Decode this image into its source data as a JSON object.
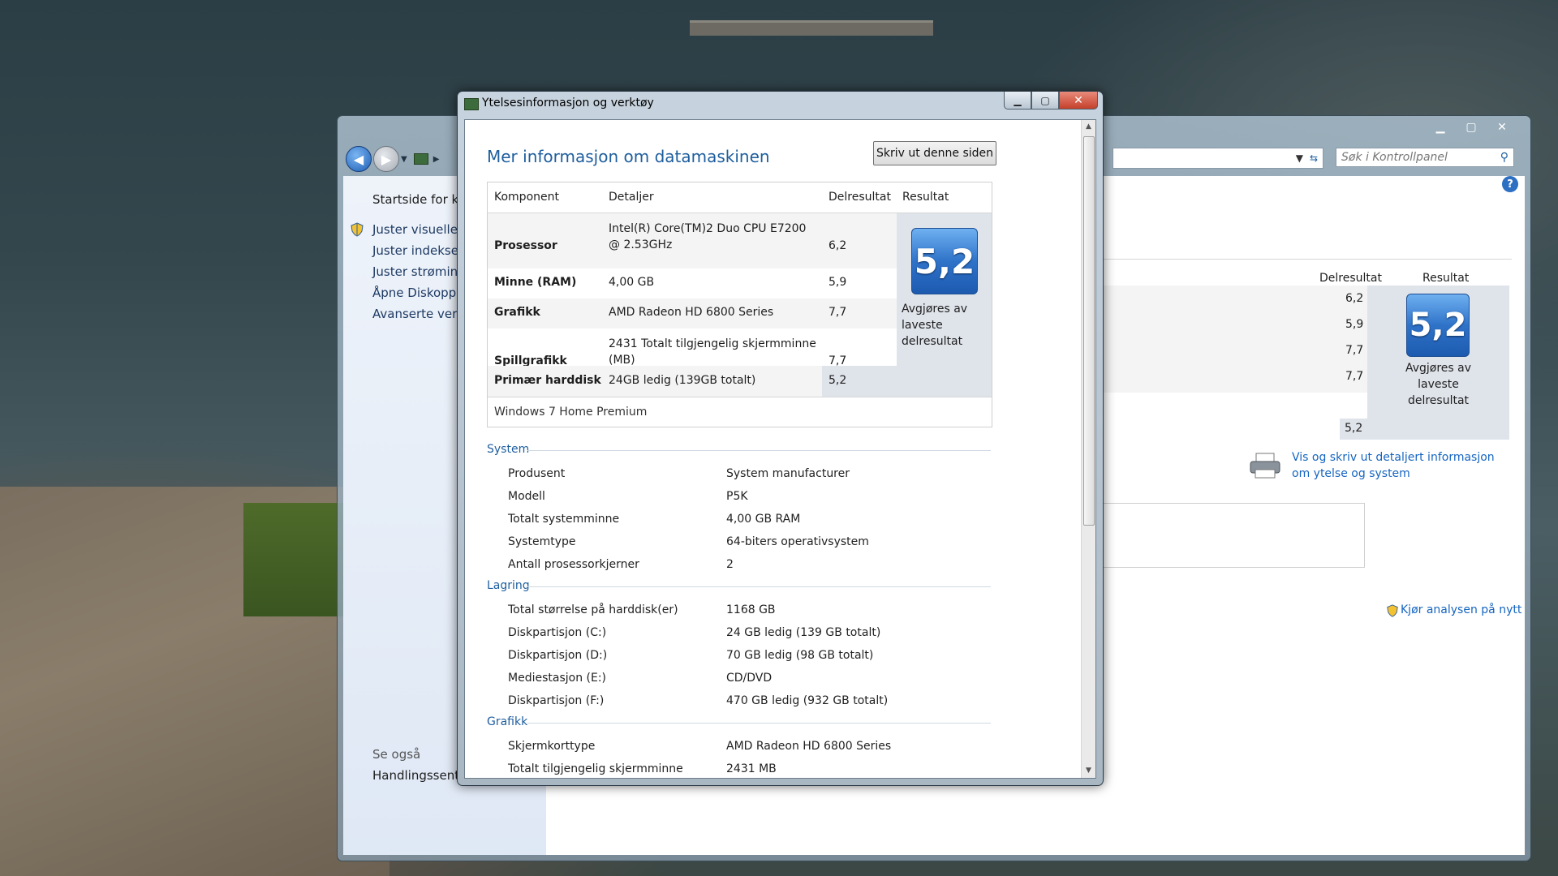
{
  "background_window": {
    "search_placeholder": "Søk i Kontrollpanel",
    "sidebar": {
      "items": [
        "Startside for ko",
        "Juster visuelle e",
        "Juster indekseri",
        "Juster strøminn",
        "Åpne Diskoppr",
        "Avanserte verkt"
      ],
      "see_also": "Se også",
      "action_center": "Handlingssenter"
    },
    "table": {
      "col_subscore": "Delresultat",
      "col_result": "Resultat",
      "scores": [
        "6,2",
        "5,9",
        "7,7",
        "7,7",
        "5,2"
      ],
      "base_score": "5,2",
      "note": "Avgjøres av laveste delresultat"
    },
    "print_link": "Vis og skriv ut detaljert informasjon om ytelse og system",
    "rerun_link": "Kjør analysen på nytt"
  },
  "dialog": {
    "title": "Ytelsesinformasjon og verktøy",
    "heading": "Mer informasjon om datamaskinen",
    "print_button": "Skriv ut denne siden",
    "components": {
      "headers": [
        "Komponent",
        "Detaljer",
        "Delresultat",
        "Resultat"
      ],
      "rows": [
        {
          "name": "Prosessor",
          "detail": "Intel(R) Core(TM)2 Duo CPU E7200 @ 2.53GHz",
          "score": "6,2"
        },
        {
          "name": "Minne (RAM)",
          "detail": "4,00 GB",
          "score": "5,9"
        },
        {
          "name": "Grafikk",
          "detail": "AMD Radeon HD 6800 Series",
          "score": "7,7"
        },
        {
          "name": "Spillgrafikk",
          "detail": "2431 Totalt tilgjengelig skjermminne (MB)",
          "score": "7,7"
        },
        {
          "name": "Primær harddisk",
          "detail": "24GB ledig (139GB totalt)",
          "score": "5,2"
        }
      ],
      "base_score": "5,2",
      "note": "Avgjøres av laveste delresultat",
      "os": "Windows 7 Home Premium"
    },
    "sections": [
      {
        "title": "System",
        "rows": [
          [
            "Produsent",
            "System manufacturer"
          ],
          [
            "Modell",
            "P5K"
          ],
          [
            "Totalt systemminne",
            "4,00 GB RAM"
          ],
          [
            "Systemtype",
            "64-biters operativsystem"
          ],
          [
            "Antall prosessorkjerner",
            "2"
          ]
        ]
      },
      {
        "title": "Lagring",
        "rows": [
          [
            "Total størrelse på harddisk(er)",
            "1168 GB"
          ],
          [
            "Diskpartisjon (C:)",
            "24 GB ledig (139 GB totalt)"
          ],
          [
            "Diskpartisjon (D:)",
            "70 GB ledig (98 GB totalt)"
          ],
          [
            "Mediestasjon (E:)",
            "CD/DVD"
          ],
          [
            "Diskpartisjon (F:)",
            "470 GB ledig (932 GB totalt)"
          ]
        ]
      },
      {
        "title": "Grafikk",
        "rows": [
          [
            "Skjermkorttype",
            "AMD Radeon HD 6800 Series"
          ],
          [
            "Totalt tilgjengelig skjermminne",
            "2431 MB"
          ]
        ]
      }
    ]
  }
}
